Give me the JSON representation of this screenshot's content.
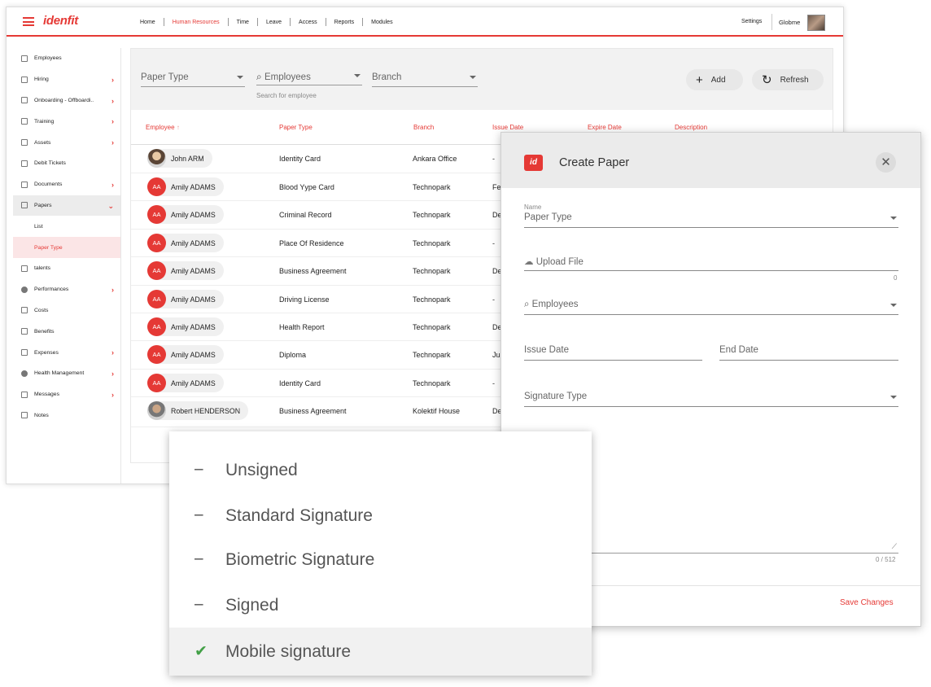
{
  "app": {
    "brand": "idenfit",
    "nav": [
      "Home",
      "Human Resources",
      "Time",
      "Leave",
      "Access",
      "Reports",
      "Modules"
    ],
    "active_nav": "Human Resources",
    "settings_label": "Settings",
    "company": "Globme"
  },
  "sidebar": {
    "items": [
      {
        "label": "Employees"
      },
      {
        "label": "Hiring"
      },
      {
        "label": "Onboarding - Offboardi.."
      },
      {
        "label": "Training"
      },
      {
        "label": "Assets"
      },
      {
        "label": "Debit Tickets"
      },
      {
        "label": "Documents"
      },
      {
        "label": "Papers"
      },
      {
        "label": "List"
      },
      {
        "label": "Paper Type"
      },
      {
        "label": "talents"
      },
      {
        "label": "Performances"
      },
      {
        "label": "Costs"
      },
      {
        "label": "Benefits"
      },
      {
        "label": "Expenses"
      },
      {
        "label": "Health Management"
      },
      {
        "label": "Messages"
      },
      {
        "label": "Notes"
      }
    ]
  },
  "filters": {
    "paper_type": "Paper Type",
    "employees": "Employees",
    "employees_hint": "Search for employee",
    "branch": "Branch",
    "add_label": "Add",
    "refresh_label": "Refresh"
  },
  "table": {
    "headers": [
      "Employee",
      "Paper Type",
      "Branch",
      "Issue Date",
      "Expire Date",
      "Description"
    ],
    "sort_indicator": "↑",
    "rows": [
      {
        "initials": "",
        "name": "John ARM",
        "paper_type": "Identity Card",
        "branch": "Ankara Office",
        "issue": "-"
      },
      {
        "initials": "AA",
        "name": "Amily ADAMS",
        "paper_type": "Blood Yype Card",
        "branch": "Technopark",
        "issue": "Feb"
      },
      {
        "initials": "AA",
        "name": "Amily ADAMS",
        "paper_type": "Criminal Record",
        "branch": "Technopark",
        "issue": "Dec"
      },
      {
        "initials": "AA",
        "name": "Amily ADAMS",
        "paper_type": "Place Of Residence",
        "branch": "Technopark",
        "issue": "-"
      },
      {
        "initials": "AA",
        "name": "Amily ADAMS",
        "paper_type": "Business Agreement",
        "branch": "Technopark",
        "issue": "Dec"
      },
      {
        "initials": "AA",
        "name": "Amily ADAMS",
        "paper_type": "Driving License",
        "branch": "Technopark",
        "issue": "-"
      },
      {
        "initials": "AA",
        "name": "Amily ADAMS",
        "paper_type": "Health Report",
        "branch": "Technopark",
        "issue": "Dec"
      },
      {
        "initials": "AA",
        "name": "Amily ADAMS",
        "paper_type": "Diploma",
        "branch": "Technopark",
        "issue": "Jun"
      },
      {
        "initials": "AA",
        "name": "Amily ADAMS",
        "paper_type": "Identity Card",
        "branch": "Technopark",
        "issue": "-"
      },
      {
        "initials": "",
        "name": "Robert HENDERSON",
        "paper_type": "Business Agreement",
        "branch": "Kolektif House",
        "issue": "Dec"
      }
    ]
  },
  "dialog": {
    "badge": "id",
    "title": "Create Paper",
    "close_glyph": "✕",
    "name_label": "Name",
    "paper_type": "Paper Type",
    "upload_label": "Upload File",
    "upload_count": "0",
    "employees": "Employees",
    "issue_date": "Issue Date",
    "end_date": "End Date",
    "signature_type": "Signature Type",
    "description_counter": "0 / 512",
    "save_label": "Save Changes"
  },
  "signature_options": [
    {
      "label": "Unsigned",
      "mark": "–",
      "selected": false
    },
    {
      "label": "Standard Signature",
      "mark": "–",
      "selected": false
    },
    {
      "label": "Biometric Signature",
      "mark": "–",
      "selected": false
    },
    {
      "label": "Signed",
      "mark": "–",
      "selected": false
    },
    {
      "label": "Mobile signature",
      "mark": "✔",
      "selected": true
    }
  ],
  "colors": {
    "accent": "#e53935",
    "check": "#43a047"
  }
}
